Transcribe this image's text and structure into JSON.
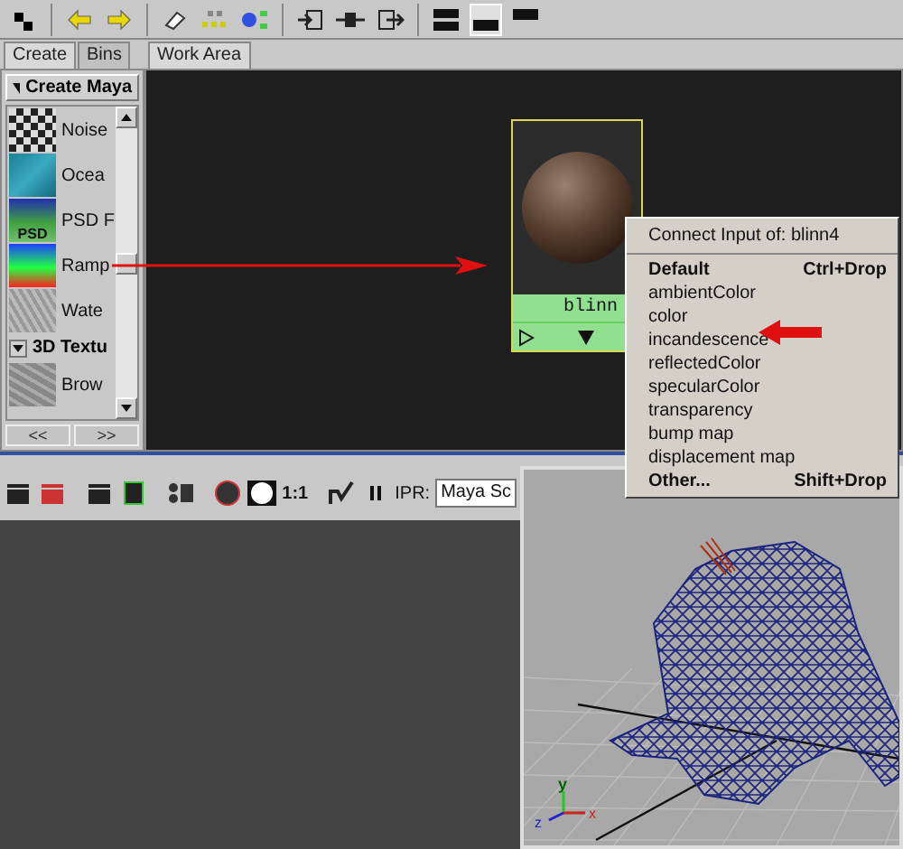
{
  "panel_tabs": [
    {
      "label": "Create",
      "selected": true
    },
    {
      "label": "Bins",
      "selected": false
    }
  ],
  "work_tabs": [
    {
      "label": "Work Area",
      "selected": true
    }
  ],
  "create_panel": {
    "header": "Create Maya",
    "items": [
      {
        "kind": "noise",
        "label": "Noise"
      },
      {
        "kind": "ocean",
        "label": "Ocea"
      },
      {
        "kind": "psd",
        "label": "PSD F",
        "badge": "PSD"
      },
      {
        "kind": "ramp",
        "label": "Ramp"
      },
      {
        "kind": "water",
        "label": "Wate"
      },
      {
        "kind": "section",
        "label": "3D Textu"
      },
      {
        "kind": "brownian",
        "label": "Brow"
      }
    ],
    "nav": [
      "<<",
      ">>"
    ]
  },
  "node": {
    "name": "blinn"
  },
  "context_menu": {
    "title": "Connect Input of: blinn4",
    "items": [
      {
        "label": "Default",
        "shortcut": "Ctrl+Drop",
        "bold": true
      },
      {
        "label": "ambientColor",
        "bold": false
      },
      {
        "label": "color",
        "bold": false
      },
      {
        "label": "incandescence",
        "bold": false
      },
      {
        "label": "reflectedColor",
        "bold": false
      },
      {
        "label": "specularColor",
        "bold": false
      },
      {
        "label": "transparency",
        "bold": false
      },
      {
        "label": "bump map",
        "bold": false
      },
      {
        "label": "displacement map",
        "bold": false
      },
      {
        "label": "Other...",
        "shortcut": "Shift+Drop",
        "bold": true
      }
    ]
  },
  "render_toolbar": {
    "ratio": "1:1",
    "ipr": "IPR:",
    "camera": "Maya Sc"
  },
  "viewport": {
    "axes": [
      "y",
      "z",
      "x"
    ]
  }
}
